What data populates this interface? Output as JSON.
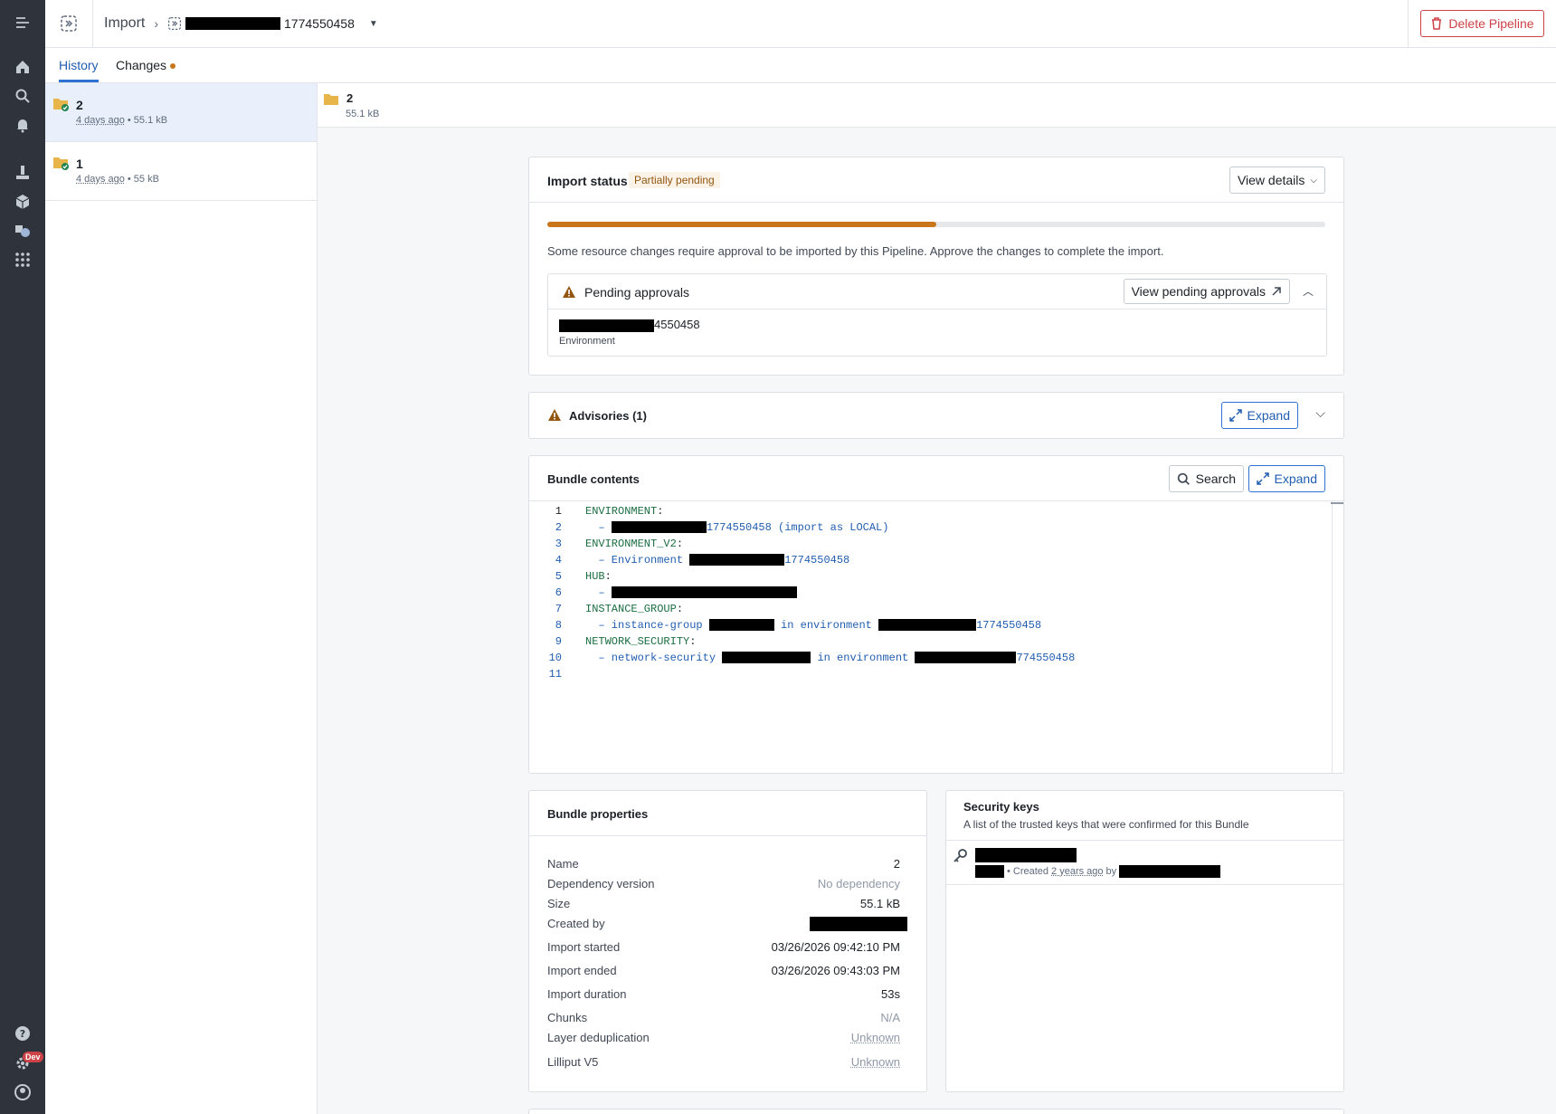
{
  "header": {
    "breadcrumb_root": "Import",
    "pipeline_name_suffix": "1774550458",
    "delete_label": "Delete Pipeline"
  },
  "tabs": [
    {
      "label": "History",
      "active": true
    },
    {
      "label": "Changes",
      "has_dot": true
    }
  ],
  "history": [
    {
      "title": "2",
      "ago": "4 days ago",
      "size": "55.1 kB",
      "selected": true
    },
    {
      "title": "1",
      "ago": "4 days ago",
      "size": "55 kB",
      "selected": false
    }
  ],
  "selected": {
    "title": "2",
    "size": "55.1 kB"
  },
  "import_status": {
    "title": "Import status",
    "badge": "Partially pending",
    "view_details_label": "View details",
    "progress": 0.5,
    "message": "Some resource changes require approval to be imported by this Pipeline. Approve the changes to complete the import.",
    "pending_title": "Pending approvals",
    "view_pending_label": "View pending approvals",
    "pending_item_suffix": "4550458",
    "pending_item_type": "Environment"
  },
  "advisories": {
    "title": "Advisories (1)",
    "expand_label": "Expand"
  },
  "bundle_contents": {
    "title": "Bundle contents",
    "search_label": "Search",
    "expand_label": "Expand",
    "lines": [
      {
        "n": "1",
        "key": "ENVIRONMENT",
        "text": ""
      },
      {
        "n": "2",
        "text": "1774550458 (import as LOCAL)"
      },
      {
        "n": "3",
        "key": "ENVIRONMENT_V2",
        "text": ""
      },
      {
        "n": "4",
        "text": "1774550458"
      },
      {
        "n": "5",
        "key": "HUB",
        "text": ""
      },
      {
        "n": "6",
        "text": ""
      },
      {
        "n": "7",
        "key": "INSTANCE_GROUP",
        "text": ""
      },
      {
        "n": "8",
        "text": "1774550458"
      },
      {
        "n": "9",
        "key": "NETWORK_SECURITY",
        "text": ""
      },
      {
        "n": "10",
        "text": "774550458"
      },
      {
        "n": "11",
        "text": ""
      }
    ],
    "line4_prefix": "– Environment",
    "line8_prefix": "– instance-group",
    "line8_mid": "in environment",
    "line10_prefix": "– network-security",
    "line10_mid": "in environment",
    "dash": "–"
  },
  "bundle_properties": {
    "title": "Bundle properties",
    "rows": [
      {
        "k": "Name",
        "v": "2"
      },
      {
        "k": "Dependency version",
        "v": "No dependency"
      },
      {
        "k": "Size",
        "v": "55.1 kB"
      },
      {
        "k": "Created by",
        "v": ""
      },
      {
        "k": "Import started",
        "v": "03/26/2026 09:42:10 PM"
      },
      {
        "k": "Import ended",
        "v": "03/26/2026 09:43:03 PM"
      },
      {
        "k": "Import duration",
        "v": "53s"
      },
      {
        "k": "Chunks",
        "v": "N/A"
      },
      {
        "k": "Layer deduplication",
        "v": "Unknown"
      },
      {
        "k": "Lilliput V5",
        "v": "Unknown"
      }
    ]
  },
  "security_keys": {
    "title": "Security keys",
    "subtitle": "A list of the trusted keys that were confirmed for this Bundle",
    "created_prefix": "• Created",
    "created_ago": "2 years ago",
    "created_by": "by"
  },
  "rail": {
    "dev_badge": "Dev"
  }
}
